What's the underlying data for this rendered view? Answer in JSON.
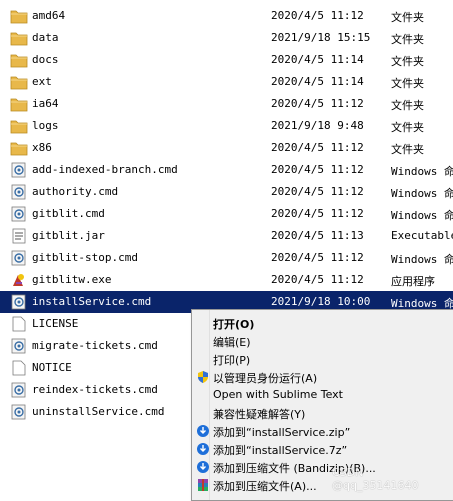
{
  "files": [
    {
      "name": "amd64",
      "date": "2020/4/5 11:12",
      "type": "文件夹",
      "icon": "folder-icon"
    },
    {
      "name": "data",
      "date": "2021/9/18 15:15",
      "type": "文件夹",
      "icon": "folder-icon"
    },
    {
      "name": "docs",
      "date": "2020/4/5 11:14",
      "type": "文件夹",
      "icon": "folder-icon"
    },
    {
      "name": "ext",
      "date": "2020/4/5 11:14",
      "type": "文件夹",
      "icon": "folder-icon"
    },
    {
      "name": "ia64",
      "date": "2020/4/5 11:12",
      "type": "文件夹",
      "icon": "folder-icon"
    },
    {
      "name": "logs",
      "date": "2021/9/18 9:48",
      "type": "文件夹",
      "icon": "folder-icon"
    },
    {
      "name": "x86",
      "date": "2020/4/5 11:12",
      "type": "文件夹",
      "icon": "folder-icon"
    },
    {
      "name": "add-indexed-branch.cmd",
      "date": "2020/4/5 11:12",
      "type": "Windows 命",
      "icon": "cmd-script-icon"
    },
    {
      "name": "authority.cmd",
      "date": "2020/4/5 11:12",
      "type": "Windows 命",
      "icon": "cmd-script-icon"
    },
    {
      "name": "gitblit.cmd",
      "date": "2020/4/5 11:12",
      "type": "Windows 命",
      "icon": "cmd-script-icon"
    },
    {
      "name": "gitblit.jar",
      "date": "2020/4/5 11:13",
      "type": "Executable",
      "icon": "jar-file-icon"
    },
    {
      "name": "gitblit-stop.cmd",
      "date": "2020/4/5 11:12",
      "type": "Windows 命",
      "icon": "cmd-script-icon"
    },
    {
      "name": "gitblitw.exe",
      "date": "2020/4/5 11:12",
      "type": "应用程序",
      "icon": "exe-app-icon"
    },
    {
      "name": "installService.cmd",
      "date": "2021/9/18 10:00",
      "type": "Windows 命",
      "icon": "cmd-script-icon",
      "selected": true
    },
    {
      "name": "LICENSE",
      "date": "",
      "type": "",
      "icon": "blank-file-icon"
    },
    {
      "name": "migrate-tickets.cmd",
      "date": "",
      "type": "",
      "icon": "cmd-script-icon"
    },
    {
      "name": "NOTICE",
      "date": "",
      "type": "",
      "icon": "blank-file-icon"
    },
    {
      "name": "reindex-tickets.cmd",
      "date": "",
      "type": "",
      "icon": "cmd-script-icon"
    },
    {
      "name": "uninstallService.cmd",
      "date": "",
      "type": "",
      "icon": "cmd-script-icon"
    }
  ],
  "context_menu": [
    {
      "label": "打开(O)",
      "bold": true,
      "icon": ""
    },
    {
      "label": "编辑(E)",
      "bold": false,
      "icon": ""
    },
    {
      "label": "打印(P)",
      "bold": false,
      "icon": ""
    },
    {
      "label": "以管理员身份运行(A)",
      "bold": false,
      "icon": "shield-icon"
    },
    {
      "label": "Open with Sublime Text",
      "bold": false,
      "icon": ""
    },
    {
      "label": "兼容性疑难解答(Y)",
      "bold": false,
      "icon": ""
    },
    {
      "label": "添加到“installService.zip”",
      "bold": false,
      "icon": "bandizip-icon"
    },
    {
      "label": "添加到“installService.7z”",
      "bold": false,
      "icon": "bandizip-icon"
    },
    {
      "label": "添加到压缩文件 (Bandizip)(B)...",
      "bold": false,
      "icon": "bandizip-icon"
    },
    {
      "label": "添加到压缩文件(A)...",
      "bold": false,
      "icon": "winrar-icon"
    }
  ],
  "watermark": "CSDN @qq_35141640",
  "colors": {
    "selection": "#0a246a",
    "folder": "#e8b84a",
    "menu_bg": "#f0f0f0",
    "bandizip": "#1e6fd9"
  }
}
